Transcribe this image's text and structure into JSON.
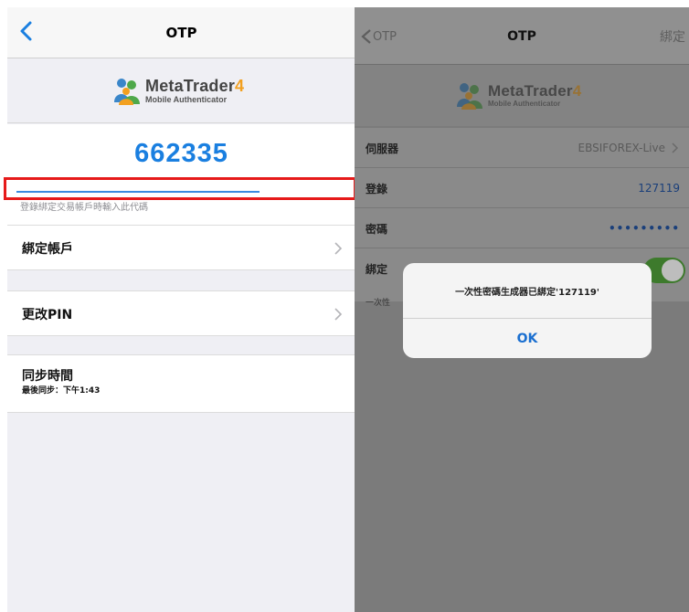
{
  "left": {
    "nav_title": "OTP",
    "logo": {
      "brand": "MetaTrader",
      "version": "4",
      "subtitle": "Mobile Authenticator"
    },
    "otp_code": "662335",
    "otp_progress": 0.69,
    "hint": "登錄綁定交易帳戶時輸入此代碼",
    "rows": [
      {
        "label": "綁定帳戶"
      },
      {
        "label": "更改PIN"
      }
    ],
    "sync": {
      "title": "同步時間",
      "subtitle": "最後同步：下午1:43"
    }
  },
  "right": {
    "back_label": "OTP",
    "nav_title": "OTP",
    "bind_button": "綁定",
    "logo": {
      "brand": "MetaTrader",
      "version": "4",
      "subtitle": "Mobile Authenticator"
    },
    "fields": [
      {
        "key": "伺服器",
        "value": "EBSIFOREX-Live"
      },
      {
        "key": "登錄",
        "value": "127119"
      },
      {
        "key": "密碼",
        "value": "•••••••••"
      },
      {
        "key": "綁定"
      }
    ],
    "bind_toggle_on": true,
    "hint_fragment": "一次性",
    "alert": {
      "message": "一次性密碼生成器已綁定'127119'",
      "ok": "OK"
    }
  },
  "colors": {
    "otp_blue": "#1a7fe0",
    "highlight_red": "#e61a1a",
    "toggle_green": "#3d7a2c"
  }
}
